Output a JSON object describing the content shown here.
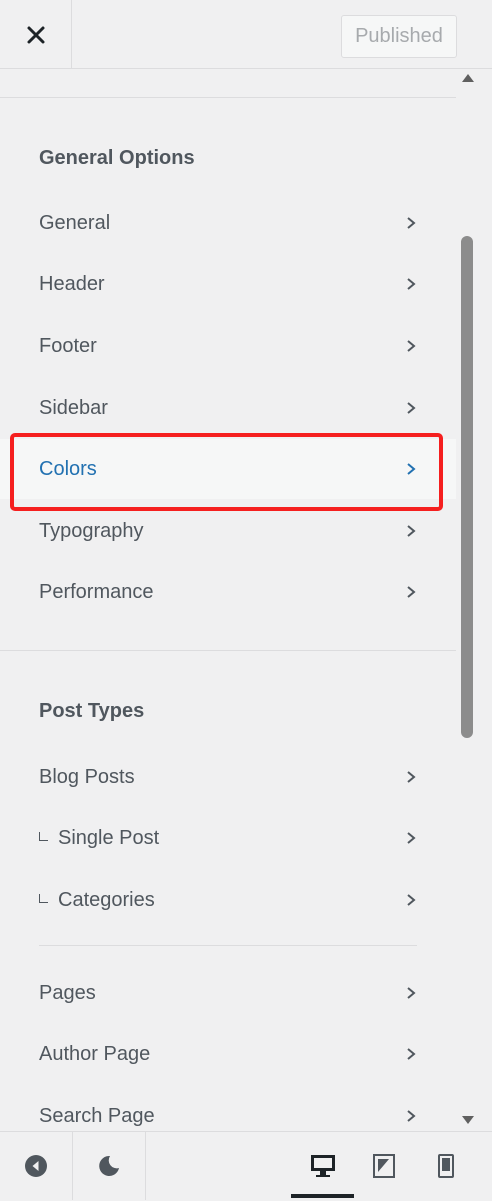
{
  "header": {
    "close_icon": "close-icon",
    "publish_label": "Published"
  },
  "sections": {
    "general_title": "General Options",
    "post_types_title": "Post Types"
  },
  "general_items": [
    "General",
    "Header",
    "Footer",
    "Sidebar",
    "Colors",
    "Typography",
    "Performance"
  ],
  "active_item": "Colors",
  "post_type_items": [
    "Blog Posts",
    "Single Post",
    "Categories"
  ],
  "page_items": [
    "Pages",
    "Author Page",
    "Search Page"
  ],
  "footer": {
    "collapse_icon": "collapse-arrow-icon",
    "dark_mode_icon": "moon-icon",
    "devices": [
      "desktop-icon",
      "tablet-icon",
      "mobile-icon"
    ],
    "active_device": "desktop"
  },
  "colors": {
    "accent": "#2271b1",
    "highlight": "#f51f1f",
    "text": "#50575e"
  }
}
